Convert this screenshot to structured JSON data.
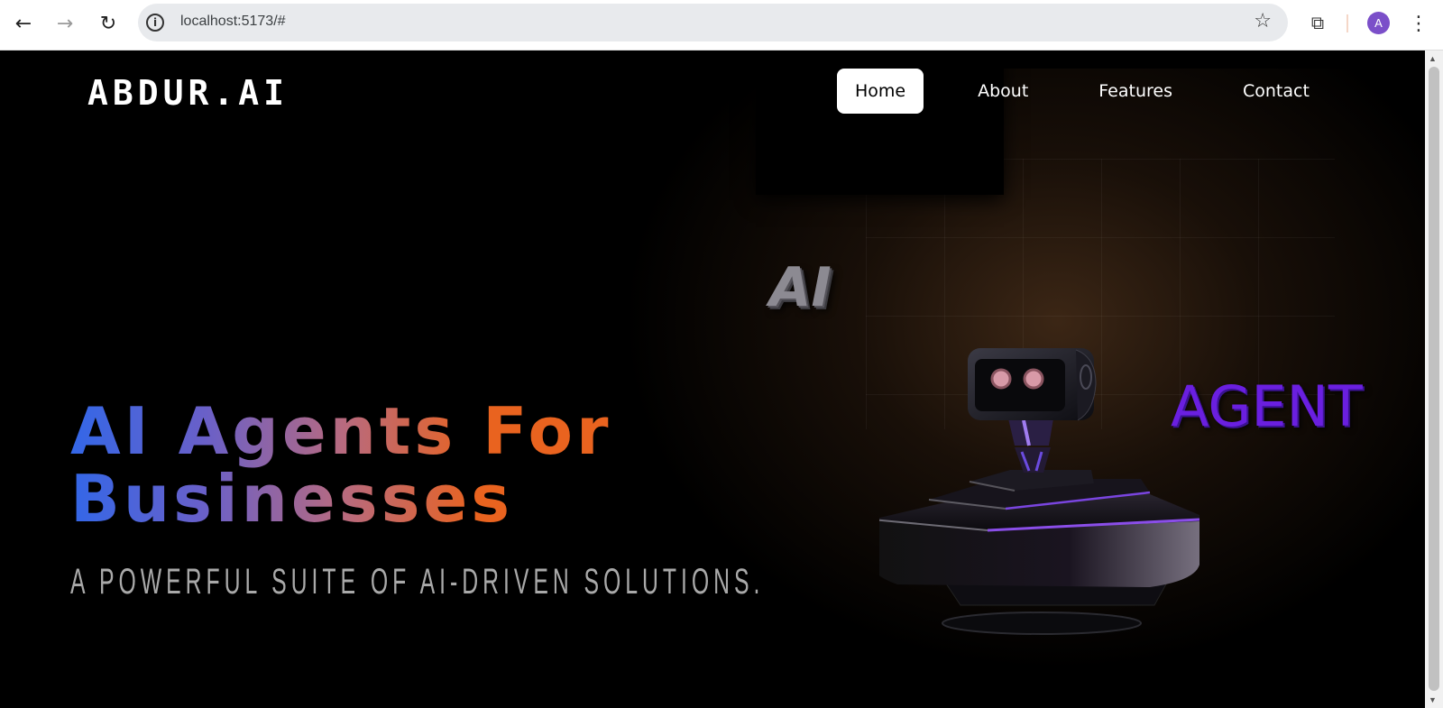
{
  "browser": {
    "url": "localhost:5173/#",
    "back_icon": "←",
    "forward_icon": "→",
    "reload_icon": "↻",
    "info_icon": "i",
    "star_icon": "☆",
    "extensions_icon": "⧉",
    "avatar_letter": "A",
    "menu_icon": "⋮"
  },
  "site": {
    "logo": "ABDUR.AI",
    "nav": [
      {
        "label": "Home",
        "active": true
      },
      {
        "label": "About",
        "active": false
      },
      {
        "label": "Features",
        "active": false
      },
      {
        "label": "Contact",
        "active": false
      }
    ]
  },
  "hero": {
    "title_line1": "AI Agents For",
    "title_line2": "Businesses",
    "subtitle": "A POWERFUL SUITE OF AI-DRIVEN SOLUTIONS.",
    "badge_ai": "AI",
    "badge_agent": "AGENT"
  },
  "colors": {
    "gradient_start": "#3367e8",
    "gradient_mid": "#b76a80",
    "gradient_end": "#e9631f",
    "agent_purple": "#6a1fe0",
    "avatar_purple": "#7b4fc9"
  },
  "scrollbar": {
    "up_icon": "▲",
    "down_icon": "▼"
  }
}
